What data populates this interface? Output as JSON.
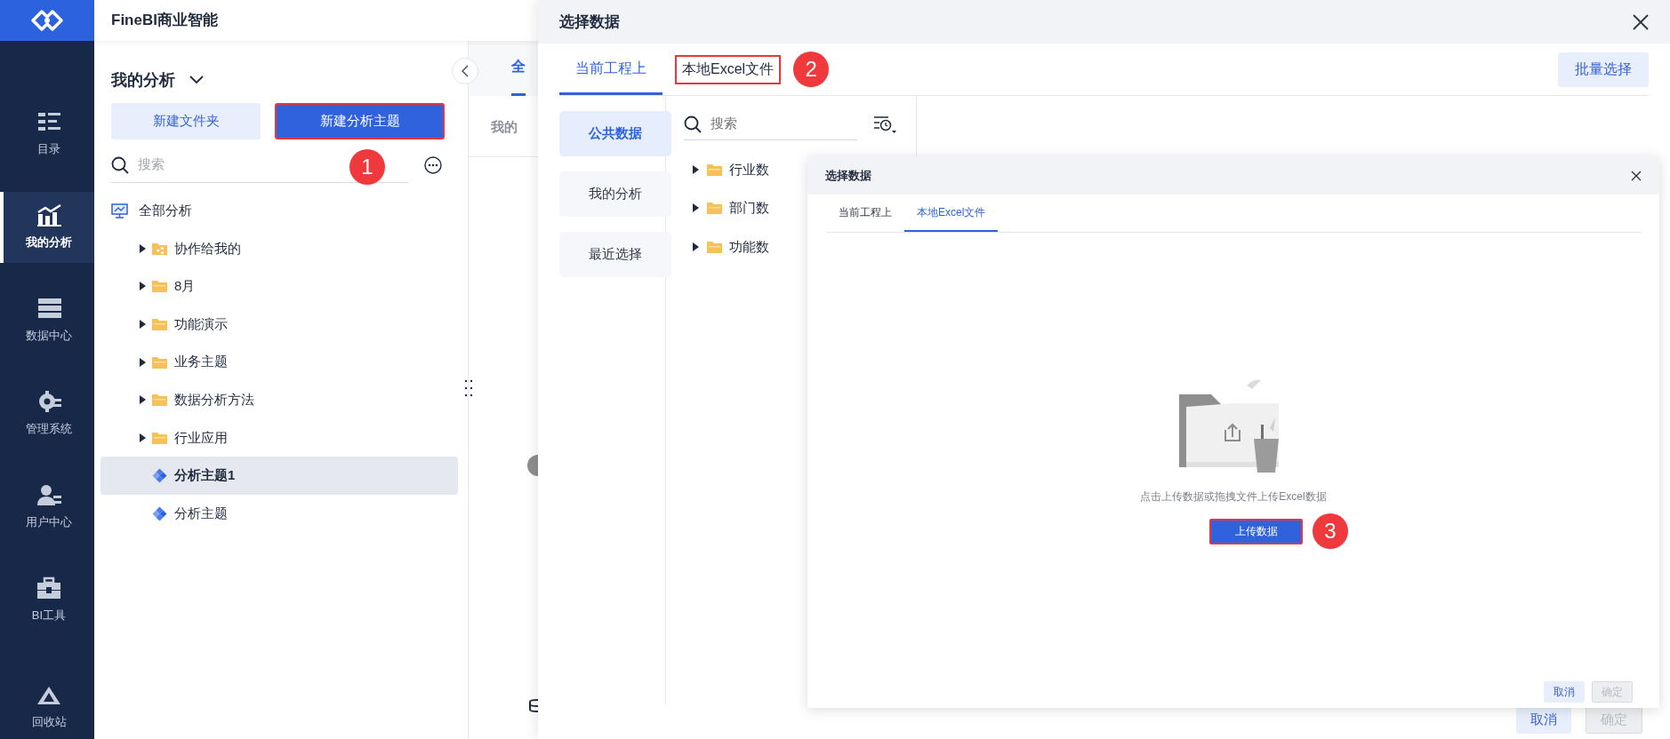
{
  "app": {
    "title": "FineBI商业智能"
  },
  "nav": [
    {
      "label": "目录",
      "selected": false
    },
    {
      "label": "我的分析",
      "selected": true
    },
    {
      "label": "数据中心",
      "selected": false
    },
    {
      "label": "管理系统",
      "selected": false
    },
    {
      "label": "用户中心",
      "selected": false
    },
    {
      "label": "BI工具",
      "selected": false
    }
  ],
  "nav_bottom": {
    "label": "回收站"
  },
  "left_panel": {
    "title": "我的分析",
    "buttons": [
      {
        "label": "新建文件夹",
        "kind": "secondary",
        "highlighted": false
      },
      {
        "label": "新建分析主题",
        "kind": "primary",
        "highlighted": true
      }
    ],
    "search": {
      "placeholder": "搜索"
    },
    "callout": "1",
    "tree": [
      {
        "label": "全部分析",
        "kind": "root",
        "selected": false,
        "children": [
          {
            "label": "协作给我的",
            "kind": "shared",
            "expanded": false,
            "selected": false
          },
          {
            "label": "8月",
            "kind": "folder",
            "expanded": false,
            "selected": false
          },
          {
            "label": "功能演示",
            "kind": "folder",
            "expanded": false,
            "selected": false
          },
          {
            "label": "业务主题",
            "kind": "folder",
            "expanded": false,
            "selected": false
          },
          {
            "label": "数据分析方法",
            "kind": "folder",
            "expanded": false,
            "selected": false
          },
          {
            "label": "行业应用",
            "kind": "folder",
            "expanded": false,
            "selected": false
          },
          {
            "label": "分析主题1",
            "kind": "subject",
            "selected": true
          },
          {
            "label": "分析主题",
            "kind": "subject",
            "selected": false
          }
        ]
      }
    ]
  },
  "background_panel": {
    "tabs": [
      {
        "label": "全",
        "selected": true
      }
    ],
    "subtitle": "我的"
  },
  "dialog": {
    "title": "选择数据",
    "tabs": [
      {
        "label": "当前工程上",
        "selected": true,
        "highlighted": false
      },
      {
        "label": "本地Excel文件",
        "selected": false,
        "highlighted": true
      }
    ],
    "callout": "2",
    "batch_button": "批量选择",
    "categories": [
      {
        "label": "公共数据",
        "selected": true
      },
      {
        "label": "我的分析",
        "selected": false
      },
      {
        "label": "最近选择",
        "selected": false
      }
    ],
    "search": {
      "placeholder": "搜索"
    },
    "tree": [
      {
        "label": "行业数",
        "expanded": false
      },
      {
        "label": "部门数",
        "expanded": false
      },
      {
        "label": "功能数",
        "expanded": false
      }
    ],
    "footer_buttons": [
      {
        "label": "取消",
        "disabled": false
      },
      {
        "label": "确定",
        "disabled": true
      }
    ]
  },
  "upload_dialog": {
    "title": "选择数据",
    "tabs": [
      {
        "label": "当前工程上",
        "selected": false
      },
      {
        "label": "本地Excel文件",
        "selected": true
      }
    ],
    "hint": "点击上传数据或拖拽文件上传Excel数据",
    "upload_button": {
      "label": "上传数据",
      "highlighted": true
    },
    "callout": "3",
    "footer_buttons": [
      {
        "label": "取消",
        "disabled": false
      },
      {
        "label": "确定",
        "disabled": true
      }
    ]
  }
}
